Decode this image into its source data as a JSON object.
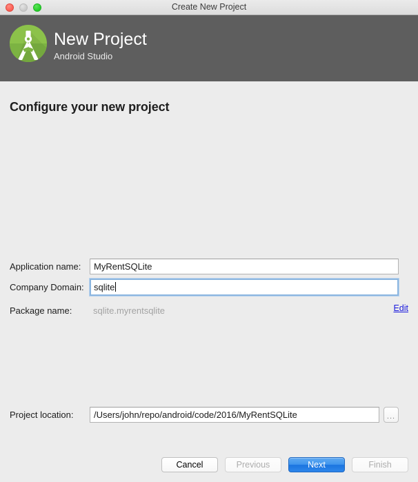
{
  "window": {
    "title": "Create New Project",
    "traffic_lights": [
      {
        "name": "close",
        "color": "#fb5d52"
      },
      {
        "name": "minimize",
        "color": "#c9c9c9"
      },
      {
        "name": "zoom",
        "color": "#24cf27"
      }
    ]
  },
  "header": {
    "title": "New Project",
    "subtitle": "Android Studio",
    "band_color": "#5e5e5e",
    "logo_color": "#7cba42",
    "logo_name": "android-studio-logo"
  },
  "main": {
    "heading": "Configure your new project",
    "fields": {
      "application_name": {
        "label": "Application name:",
        "value": "MyRentSQLite",
        "focused": false
      },
      "company_domain": {
        "label": "Company Domain:",
        "value": "sqlite",
        "focused": true
      },
      "package_name": {
        "label": "Package name:",
        "value": "sqlite.myrentsqlite",
        "readonly": true,
        "edit_link": "Edit",
        "edit_link_color": "#1818dd"
      },
      "project_location": {
        "label": "Project location:",
        "value": "/Users/john/repo/android/code/2016/MyRentSQLite",
        "browse_label": "..."
      }
    }
  },
  "buttons": {
    "cancel": {
      "label": "Cancel",
      "state": "enabled"
    },
    "previous": {
      "label": "Previous",
      "state": "disabled"
    },
    "next": {
      "label": "Next",
      "state": "default",
      "accent_color": "#2e86ea"
    },
    "finish": {
      "label": "Finish",
      "state": "disabled"
    }
  }
}
